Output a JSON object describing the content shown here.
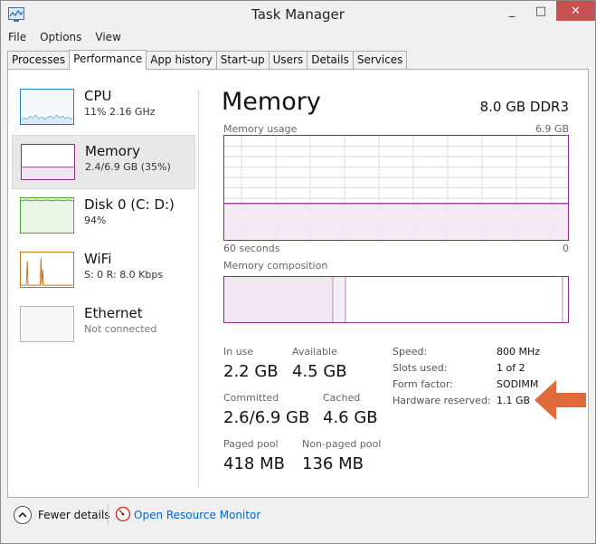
{
  "window": {
    "title": "Task Manager",
    "minimize_glyph": "_",
    "maximize_glyph": "□",
    "close_glyph": "✕"
  },
  "menu": {
    "file": "File",
    "options": "Options",
    "view": "View"
  },
  "tabs": [
    "Processes",
    "Performance",
    "App history",
    "Start-up",
    "Users",
    "Details",
    "Services"
  ],
  "sidebar": {
    "items": [
      {
        "name": "CPU",
        "sub": "11% 2.16 GHz",
        "color": "#1f7fbf"
      },
      {
        "name": "Memory",
        "sub": "2.4/6.9 GB (35%)",
        "color": "#8b2a8b"
      },
      {
        "name": "Disk 0 (C: D:)",
        "sub": "94%",
        "color": "#4aa52e"
      },
      {
        "name": "WiFi",
        "sub": "S: 0 R: 8.0 Kbps",
        "color": "#c1761b"
      },
      {
        "name": "Ethernet",
        "sub": "Not connected",
        "color": "#a0a0a0"
      }
    ]
  },
  "main": {
    "title": "Memory",
    "spec": "8.0 GB DDR3",
    "usage_label": "Memory usage",
    "usage_max": "6.9 GB",
    "time_left": "60 seconds",
    "time_right": "0",
    "composition_label": "Memory composition",
    "usage_level": 0.35,
    "accent": "#8b2a8b"
  },
  "stats": {
    "in_use_label": "In use",
    "in_use": "2.2 GB",
    "available_label": "Available",
    "available": "4.5 GB",
    "committed_label": "Committed",
    "committed": "2.6/6.9 GB",
    "cached_label": "Cached",
    "cached": "4.6 GB",
    "paged_label": "Paged pool",
    "paged": "418 MB",
    "nonpaged_label": "Non-paged pool",
    "nonpaged": "136 MB"
  },
  "details": {
    "speed_label": "Speed:",
    "speed": "800 MHz",
    "slots_label": "Slots used:",
    "slots": "1 of 2",
    "form_label": "Form factor:",
    "form": "SODIMM",
    "reserved_label": "Hardware reserved:",
    "reserved": "1.1 GB"
  },
  "footer": {
    "fewer": "Fewer details",
    "resource_monitor": "Open Resource Monitor"
  },
  "arrow_color": "#e06a3a"
}
